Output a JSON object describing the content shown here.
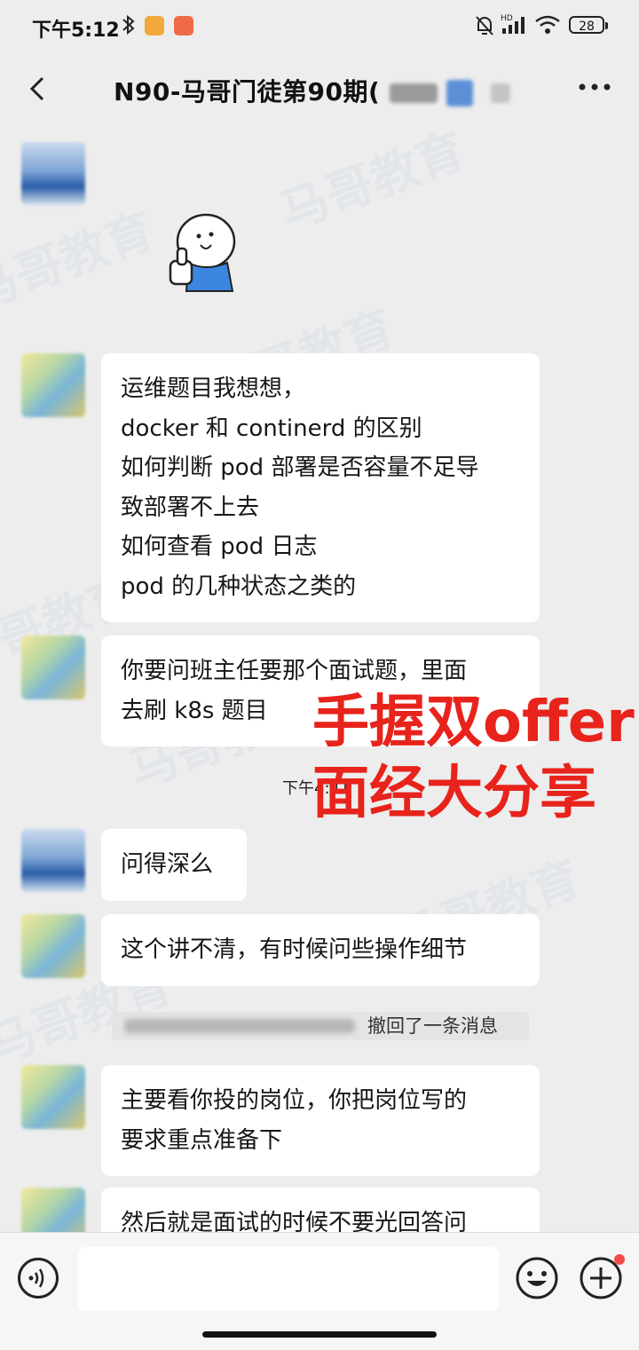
{
  "status_bar": {
    "time": "下午5:12",
    "battery": "28"
  },
  "header": {
    "title": "N90-马哥门徒第90期("
  },
  "watermark": {
    "text": "马哥教育"
  },
  "messages": {
    "m1_lines": [
      "运维题目我想想，",
      "docker 和 continerd 的区别",
      "如何判断 pod 部署是否容量不足导",
      "致部署不上去",
      "如何查看 pod 日志",
      "pod 的几种状态之类的"
    ],
    "m2_lines": [
      "你要问班主任要那个面试题，里面",
      "去刷 k8s 题目"
    ],
    "time_label": "下午4:41",
    "m3": "问得深么",
    "m4": "这个讲不清，有时候问些操作细节",
    "recall_notice": "撤回了一条消息",
    "m5_lines": [
      "主要看你投的岗位，你把岗位写的",
      "要求重点准备下"
    ],
    "m6": "然后就是面试的时候不要光回答问"
  },
  "overlay": {
    "line1": "手握双offer",
    "line2": "面经大分享"
  },
  "colors": {
    "overlay_red": "#e8231b",
    "background": "#ededed",
    "bubble": "#ffffff"
  }
}
